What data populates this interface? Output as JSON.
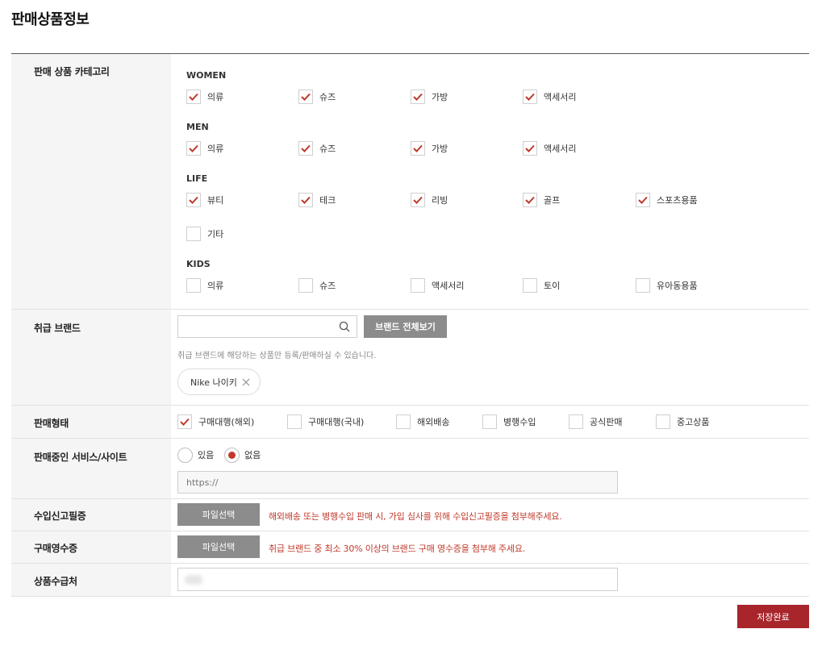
{
  "page_title": "판매상품정보",
  "rows": {
    "category": {
      "label": "판매 상품 카테고리",
      "groups": [
        {
          "title": "WOMEN",
          "items": [
            {
              "label": "의류",
              "checked": true
            },
            {
              "label": "슈즈",
              "checked": true
            },
            {
              "label": "가방",
              "checked": true
            },
            {
              "label": "액세서리",
              "checked": true
            }
          ]
        },
        {
          "title": "MEN",
          "items": [
            {
              "label": "의류",
              "checked": true
            },
            {
              "label": "슈즈",
              "checked": true
            },
            {
              "label": "가방",
              "checked": true
            },
            {
              "label": "액세서리",
              "checked": true
            }
          ]
        },
        {
          "title": "LIFE",
          "items": [
            {
              "label": "뷰티",
              "checked": true
            },
            {
              "label": "테크",
              "checked": true
            },
            {
              "label": "리빙",
              "checked": true
            },
            {
              "label": "골프",
              "checked": true
            },
            {
              "label": "스포츠용품",
              "checked": true
            },
            {
              "label": "기타",
              "checked": false
            }
          ]
        },
        {
          "title": "KIDS",
          "items": [
            {
              "label": "의류",
              "checked": false
            },
            {
              "label": "슈즈",
              "checked": false
            },
            {
              "label": "액세서리",
              "checked": false
            },
            {
              "label": "토이",
              "checked": false
            },
            {
              "label": "유아동용품",
              "checked": false
            }
          ]
        }
      ]
    },
    "brand": {
      "label": "취급 브랜드",
      "search_placeholder": "",
      "view_all_label": "브랜드 전체보기",
      "helper_text": "취급 브랜드에 해당하는 상품만 등록/판매하실 수 있습니다.",
      "selected_tag": "Nike 나이키"
    },
    "sales_type": {
      "label": "판매형태",
      "options": [
        {
          "label": "구매대행(해외)",
          "checked": true
        },
        {
          "label": "구매대행(국내)",
          "checked": false
        },
        {
          "label": "해외배송",
          "checked": false
        },
        {
          "label": "병행수입",
          "checked": false
        },
        {
          "label": "공식판매",
          "checked": false
        },
        {
          "label": "중고상품",
          "checked": false
        }
      ]
    },
    "service": {
      "label": "판매중인 서비스/사이트",
      "options": [
        {
          "label": "있음",
          "selected": false
        },
        {
          "label": "없음",
          "selected": true
        }
      ],
      "url_placeholder": "https://"
    },
    "import_cert": {
      "label": "수입신고필증",
      "button_label": "파일선택",
      "note": "해외배송 또는 병행수입 판매 시, 가입 심사를 위해 수입신고필증을 첨부해주세요."
    },
    "receipt": {
      "label": "구매영수증",
      "button_label": "파일선택",
      "note": "취급 브랜드 중 최소 30% 이상의 브랜드 구매 영수증을 첨부해 주세요."
    },
    "supplier": {
      "label": "상품수급처"
    }
  },
  "save_label": "저장완료",
  "colors": {
    "accent": "#c0392b",
    "save": "#a8252b",
    "button_gray": "#8c8c8c"
  }
}
